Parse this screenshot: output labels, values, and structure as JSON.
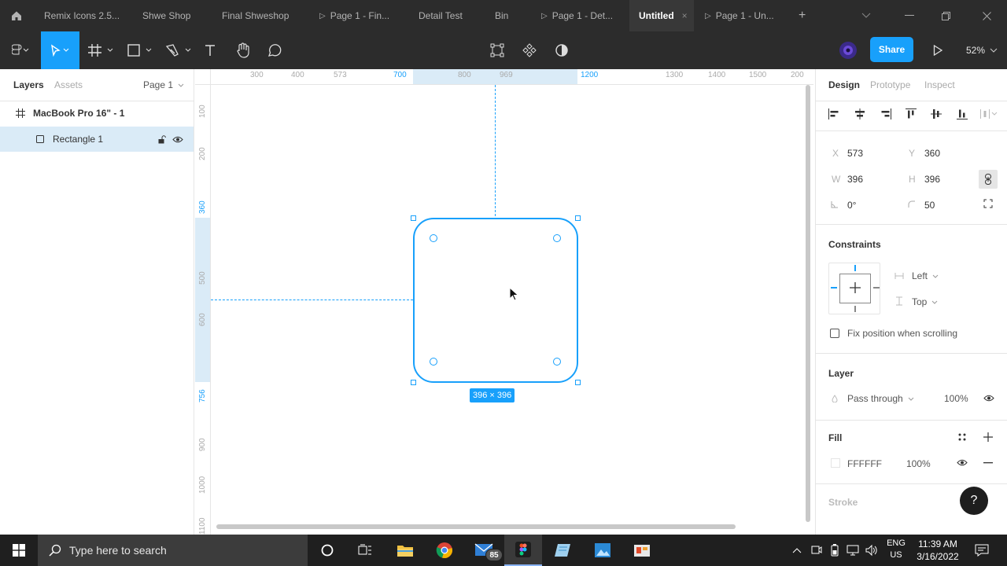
{
  "tabs": [
    {
      "label": "Remix Icons 2.5...",
      "play": false
    },
    {
      "label": "Shwe Shop",
      "play": false
    },
    {
      "label": "Final Shweshop",
      "play": false
    },
    {
      "label": "Page 1 - Fin...",
      "play": true
    },
    {
      "label": "Detail Test",
      "play": false
    },
    {
      "label": "Bin",
      "play": false
    },
    {
      "label": "Page 1 - Det...",
      "play": true
    },
    {
      "label": "Untitled",
      "play": false,
      "active": true
    },
    {
      "label": "Page 1 - Un...",
      "play": true
    }
  ],
  "toolbar": {
    "share_label": "Share",
    "zoom": "52%"
  },
  "left_panel": {
    "layers_tab": "Layers",
    "assets_tab": "Assets",
    "page_selector": "Page 1",
    "frame_name": "MacBook Pro 16\" - 1",
    "layer_name": "Rectangle 1"
  },
  "rulers": {
    "h_labels": [
      "200",
      "300",
      "400",
      "573",
      "700",
      "800",
      "969",
      "1200",
      "1300",
      "1400",
      "1500"
    ],
    "v_labels": [
      "100",
      "200",
      "360",
      "500",
      "600",
      "756",
      "900",
      "1000",
      "1100"
    ]
  },
  "canvas": {
    "size_badge": "396 × 396"
  },
  "right_panel": {
    "tabs": [
      "Design",
      "Prototype",
      "Inspect"
    ],
    "x_label": "X",
    "x": "573",
    "y_label": "Y",
    "y": "360",
    "w_label": "W",
    "w": "396",
    "h_label": "H",
    "h": "396",
    "rotation": "0°",
    "radius": "50",
    "constraints_title": "Constraints",
    "constraint_h": "Left",
    "constraint_v": "Top",
    "fix_scroll_label": "Fix position when scrolling",
    "layer_title": "Layer",
    "blend_mode": "Pass through",
    "layer_opacity": "100%",
    "fill_title": "Fill",
    "fill_hex": "FFFFFF",
    "fill_opacity": "100%",
    "stroke_title": "Stroke",
    "help": "?"
  },
  "taskbar": {
    "search_placeholder": "Type here to search",
    "mail_badge": "85",
    "lang": "ENG",
    "region": "US",
    "time": "11:39 AM",
    "date": "3/16/2022"
  },
  "colors": {
    "accent": "#18a0fb",
    "dark": "#2c2c2c",
    "selection_bg": "#daebf7"
  }
}
